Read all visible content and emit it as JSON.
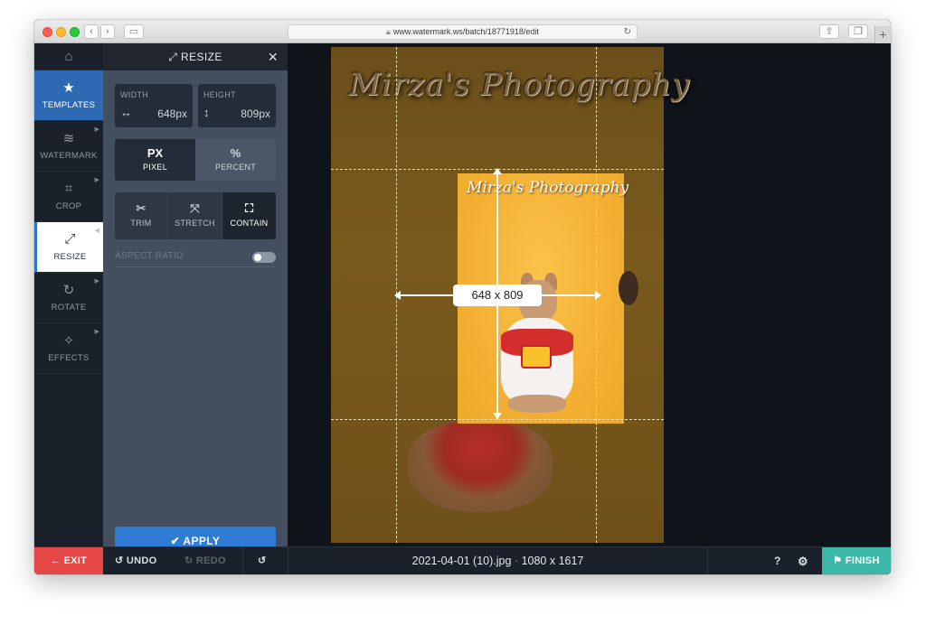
{
  "browser": {
    "url": "www.watermark.ws/batch/18771918/edit"
  },
  "nav": {
    "items": [
      {
        "label": ""
      },
      {
        "label": "TEMPLATES"
      },
      {
        "label": "WATERMARK"
      },
      {
        "label": "CROP"
      },
      {
        "label": "RESIZE"
      },
      {
        "label": "ROTATE"
      },
      {
        "label": "EFFECTS"
      }
    ]
  },
  "panel": {
    "title": "RESIZE",
    "width": {
      "label": "WIDTH",
      "value": "648px"
    },
    "height": {
      "label": "HEIGHT",
      "value": "809px"
    },
    "units": [
      {
        "big": "PX",
        "small": "PIXEL",
        "selected": true
      },
      {
        "big": "%",
        "small": "PERCENT",
        "selected": false
      }
    ],
    "modes": [
      {
        "label": "TRIM",
        "selected": false
      },
      {
        "label": "STRETCH",
        "selected": false
      },
      {
        "label": "CONTAIN",
        "selected": true
      }
    ],
    "aspect_ratio_label": "ASPECT RATIO",
    "apply_label": "APPLY"
  },
  "canvas": {
    "watermark_text": "Mirza's Photography",
    "size_badge": "648 x 809"
  },
  "bottom": {
    "exit_label": "EXIT",
    "undo_label": "UNDO",
    "redo_label": "REDO",
    "filename": "2021-04-01 (10).jpg",
    "dimensions": "1080 x 1617",
    "finish_label": "FINISH"
  },
  "colors": {
    "accent_blue": "#2f7bd6",
    "exit_red": "#e64646",
    "finish_teal": "#3db8a8"
  }
}
